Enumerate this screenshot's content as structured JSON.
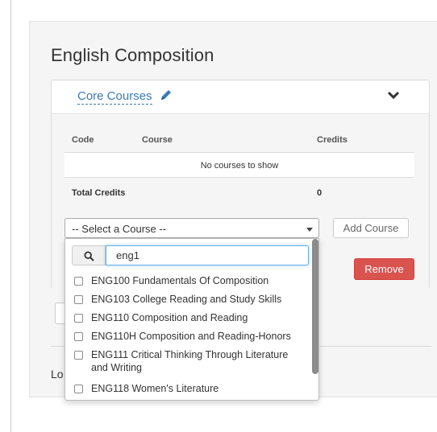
{
  "program": {
    "title": "English Composition"
  },
  "section": {
    "name": "Core Courses",
    "table": {
      "headers": [
        "Code",
        "Course",
        "Credits"
      ],
      "empty_message": "No courses to show",
      "total_label": "Total Credits",
      "total_value": "0"
    },
    "select": {
      "placeholder": "-- Select a Course --"
    },
    "add_button": "Add Course",
    "remove_button": "Remove"
  },
  "dropdown": {
    "search_value": "eng1",
    "options": [
      {
        "label": "ENG100 Fundamentals Of Composition",
        "checked": false
      },
      {
        "label": "ENG103 College Reading and Study Skills",
        "checked": false
      },
      {
        "label": "ENG110 Composition and Reading",
        "checked": false
      },
      {
        "label": "ENG110H Composition and Reading-Honors",
        "checked": false
      },
      {
        "label": "ENG111 Critical Thinking Through Literature and Writing",
        "checked": false
      },
      {
        "label": "ENG118 Women's Literature",
        "checked": false
      }
    ]
  },
  "footer": {
    "clipped_label": "Lo"
  },
  "colors": {
    "link": "#3a7ab7",
    "danger": "#d9534f",
    "focus": "#66afe9"
  },
  "icons": [
    "pencil-icon",
    "chevron-down-icon",
    "search-icon",
    "caret-down-icon"
  ]
}
